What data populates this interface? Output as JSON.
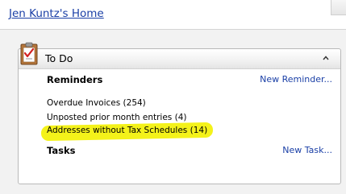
{
  "header": {
    "title": "Jen Kuntz's Home"
  },
  "todo_panel": {
    "title": "To Do",
    "icon": "clipboard-checklist-icon",
    "collapse_icon": "chevron-up-icon",
    "reminders": {
      "heading": "Reminders",
      "action": "New Reminder...",
      "items": [
        "Overdue Invoices (254)",
        "Unposted prior month entries (4)",
        "Addresses without Tax Schedules (14)"
      ],
      "highlight_color": "#f4f21a"
    },
    "tasks": {
      "heading": "Tasks",
      "action": "New Task..."
    }
  },
  "colors": {
    "link": "#1a3fa6",
    "panel_border": "#b9b9b9",
    "page_background": "#f2f2f2"
  }
}
